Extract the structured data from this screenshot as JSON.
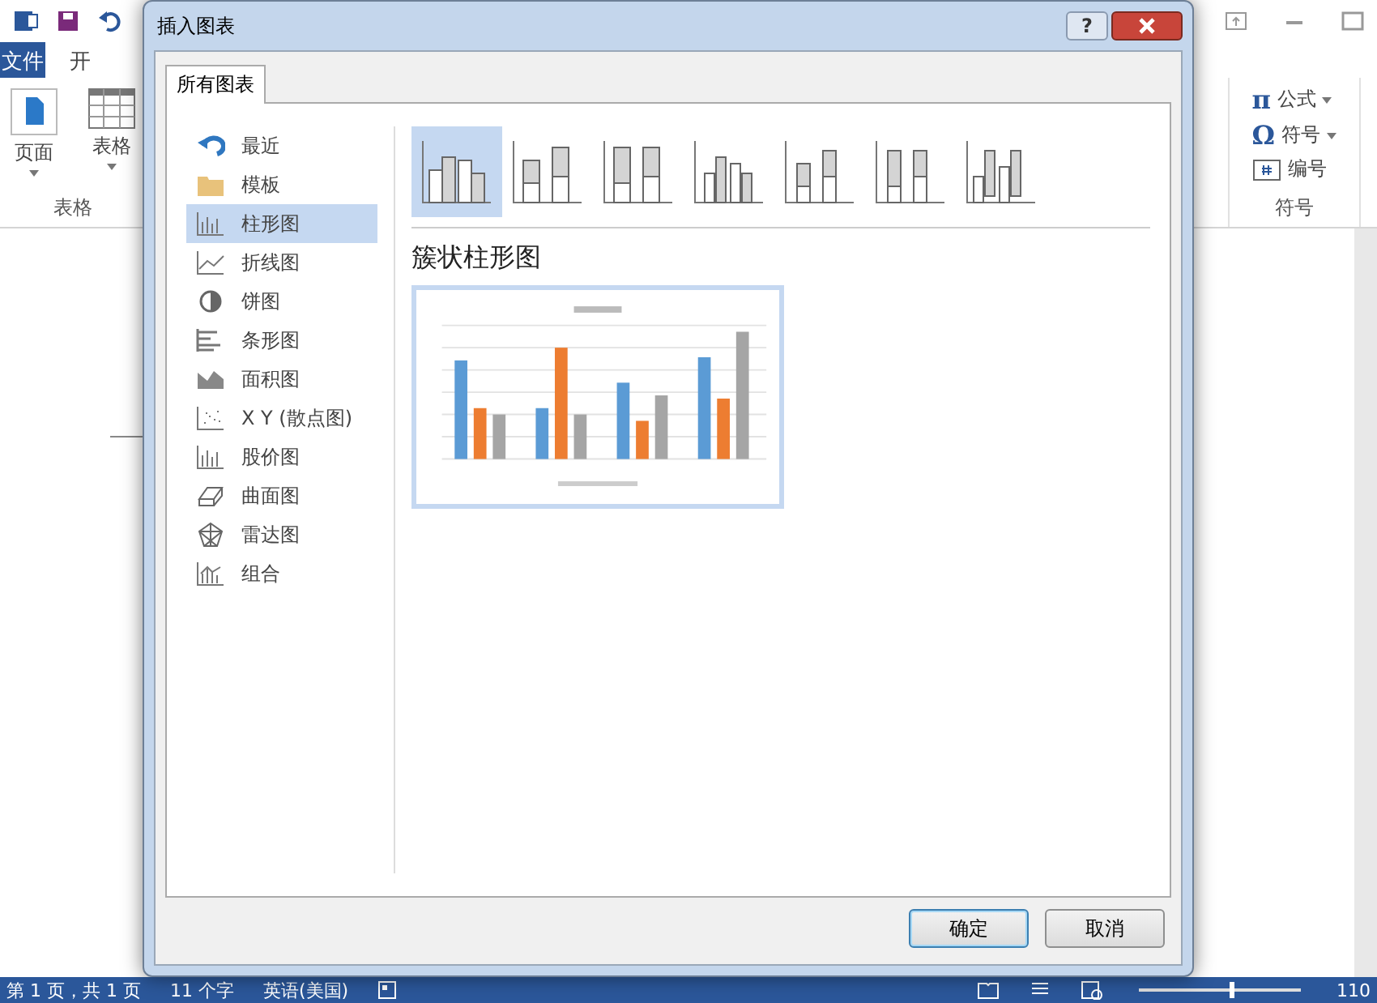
{
  "word": {
    "tabs": [
      {
        "label": "文件",
        "selected": true
      },
      {
        "label": "开",
        "selected": false
      }
    ],
    "ribbon_left": [
      {
        "label": "页面",
        "kind": "page"
      },
      {
        "label": "表格",
        "kind": "table"
      }
    ],
    "ribbon_left_group": "表格",
    "ribbon_right": [
      {
        "label": "公式",
        "kind": "equation",
        "icon": "π",
        "dropdown": true
      },
      {
        "label": "符号",
        "kind": "symbol",
        "icon": "Ω",
        "dropdown": true
      },
      {
        "label": "编号",
        "kind": "number",
        "dropdown": false
      }
    ],
    "ribbon_right_group": "符号",
    "status_bar": [
      "第 1 页，共 1 页",
      "11 个字",
      "英语(美国)"
    ],
    "zoom": "110",
    "zoom_slider": {
      "level": 0.56
    }
  },
  "dialog": {
    "title": "插入图表",
    "help": "?",
    "tab": "所有图表",
    "categories": [
      {
        "label": "最近",
        "kind": "recent",
        "selected": false
      },
      {
        "label": "模板",
        "kind": "folder",
        "selected": false
      },
      {
        "label": "柱形图",
        "kind": "column",
        "selected": true
      },
      {
        "label": "折线图",
        "kind": "line",
        "selected": false
      },
      {
        "label": "饼图",
        "kind": "pie",
        "selected": false
      },
      {
        "label": "条形图",
        "kind": "bar",
        "selected": false
      },
      {
        "label": "面积图",
        "kind": "area",
        "selected": false
      },
      {
        "label": "X Y (散点图)",
        "kind": "scatter",
        "selected": false
      },
      {
        "label": "股价图",
        "kind": "stock",
        "selected": false
      },
      {
        "label": "曲面图",
        "kind": "surface",
        "selected": false
      },
      {
        "label": "雷达图",
        "kind": "radar",
        "selected": false
      },
      {
        "label": "组合",
        "kind": "combo",
        "selected": false
      }
    ],
    "subtypes": [
      {
        "kind": "clustered",
        "selected": true
      },
      {
        "kind": "stacked",
        "selected": false
      },
      {
        "kind": "percent",
        "selected": false
      },
      {
        "kind": "clustered3d",
        "selected": false
      },
      {
        "kind": "stacked3d",
        "selected": false
      },
      {
        "kind": "percent3d",
        "selected": false
      },
      {
        "kind": "column3d",
        "selected": false
      }
    ],
    "heading": "簇状柱形图",
    "buttons": [
      {
        "label": "确定",
        "default": true
      },
      {
        "label": "取消",
        "default": false
      }
    ]
  }
}
